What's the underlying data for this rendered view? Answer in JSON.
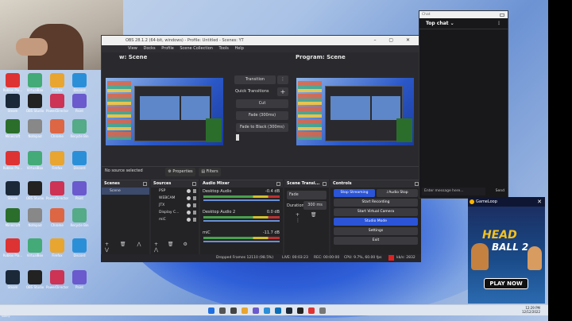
{
  "obs": {
    "window_title": "OBS 28.1.2 (64-bit, windows) - Profile: Untitled - Scenes: YT",
    "menu": [
      "View",
      "Docks",
      "Profile",
      "Scene Collection",
      "Tools",
      "Help"
    ],
    "preview_label": "w: Scene",
    "program_label": "Program: Scene",
    "transition_button": "Transition",
    "quick_transitions": "Quick Transitions",
    "cut": "Cut",
    "fade_300": "Fade (300ms)",
    "fade_black": "Fade to Black (300ms)",
    "no_source": "No source selected",
    "properties": "Properties",
    "filters": "Filters",
    "scenes": {
      "title": "Scenes",
      "items": [
        "Scene"
      ]
    },
    "sources": {
      "title": "Sources",
      "items": [
        "PSP",
        "WEBCAM",
        "JTX",
        "Display C...",
        "miC"
      ]
    },
    "audio": {
      "title": "Audio Mixer",
      "channels": [
        {
          "name": "Desktop Audio",
          "db": "-0.4 dB"
        },
        {
          "name": "Desktop Audio 2",
          "db": "0.0 dB"
        },
        {
          "name": "miC",
          "db": "-11.7 dB"
        }
      ]
    },
    "scene_trans": {
      "title": "Scene Transi...",
      "type": "Fade",
      "duration_label": "Duration",
      "duration": "300 ms"
    },
    "controls": {
      "title": "Controls",
      "stop_streaming": "Stop Streaming",
      "audio_stop": "♪Audio Stop",
      "start_recording": "Start Recording",
      "start_virtual_camera": "Start Virtual Camera",
      "studio_mode": "Studio Mode",
      "settings": "Settings",
      "exit": "Exit"
    },
    "status": {
      "dropped": "Dropped Frames 12110 (98.5%)",
      "live": "LIVE: 00:03:23",
      "rec": "REC: 00:00:00",
      "cpu": "CPU: 9.7%, 60.00 fps",
      "kbps": "kb/s: 2832"
    }
  },
  "chat": {
    "window_label": "Chat",
    "header": "Top chat",
    "placeholder": "Enter message here...",
    "send": "Send"
  },
  "ad": {
    "brand": "GameLoop",
    "logo_top": "HEAD",
    "logo_bottom": "BALL 2",
    "cta": "PLAY NOW"
  },
  "desktop": {
    "icons": [
      "Roblox Pla...",
      "VirtualBox",
      "Firefox",
      "Discord",
      "Steam",
      "OBS Studio",
      "PowerDirector",
      "Paint",
      "Minecraft",
      "Notepad",
      "Chrome",
      "Recycle Bin"
    ]
  },
  "taskbar": {
    "time": "12:29 PM",
    "date": "12/12/2022"
  },
  "search_hint": "sunny"
}
